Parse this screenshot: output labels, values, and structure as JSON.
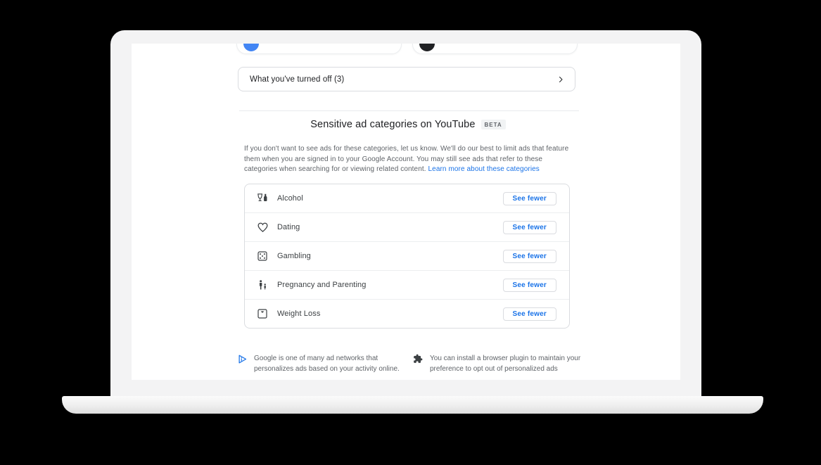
{
  "page": {
    "device": "laptop-mockup",
    "background": "#000000"
  },
  "top_cards": [
    {
      "icon": "blue-circle-avatar",
      "color": "#4285f4"
    },
    {
      "icon": "dark-circle-avatar",
      "color": "#202124"
    }
  ],
  "turned_off": {
    "label": "What you've turned off (3)",
    "chevron": "chevron-right-icon"
  },
  "section": {
    "title": "Sensitive ad categories on YouTube",
    "badge": "BETA",
    "description": "If you don't want to see ads for these categories, let us know. We'll do our best to limit ads that feature them when you are signed in to your Google Account. You may still see ads that refer to these categories when searching for or viewing related content.",
    "link": "Learn more about these categories"
  },
  "categories": [
    {
      "name": "Alcohol",
      "icon": "alcohol-icon",
      "action": "See fewer"
    },
    {
      "name": "Dating",
      "icon": "heart-icon",
      "action": "See fewer"
    },
    {
      "name": "Gambling",
      "icon": "dice-icon",
      "action": "See fewer"
    },
    {
      "name": "Pregnancy and Parenting",
      "icon": "family-icon",
      "action": "See fewer"
    },
    {
      "name": "Weight Loss",
      "icon": "scale-icon",
      "action": "See fewer"
    }
  ],
  "footer": [
    {
      "icon": "adchoices-icon",
      "text": "Google is one of many ad networks that personalizes ads based on your activity online."
    },
    {
      "icon": "puzzle-icon",
      "text": "You can install a browser plugin to maintain your preference to opt out of personalized ads"
    }
  ],
  "colors": {
    "accent_blue": "#1a73e8",
    "icon_blue": "#4285f4",
    "text_dark": "#202124",
    "text_gray": "#5f6368",
    "border": "#dadce0",
    "badge_bg": "#f1f3f4",
    "frame": "#f3f3f4"
  }
}
